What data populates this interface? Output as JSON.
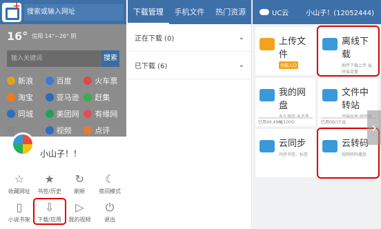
{
  "browser": {
    "url_placeholder": "搜索或输入网址",
    "weather": {
      "temp": "16°",
      "detail": "信阳 14°~26° 阴"
    },
    "search": {
      "placeholder": "输入关键词",
      "button": "搜索"
    },
    "sites": [
      {
        "label": "新浪",
        "color": "#e3a11b"
      },
      {
        "label": "百度",
        "color": "#3a7bd5"
      },
      {
        "label": "火车票",
        "color": "#e04848"
      },
      {
        "label": "淘宝",
        "color": "#f27a1a"
      },
      {
        "label": "亚马逊",
        "color": "#2a6bb7"
      },
      {
        "label": "赶集",
        "color": "#3bae4a"
      },
      {
        "label": "同城",
        "color": "#2d6ec1"
      },
      {
        "label": "美团网",
        "color": "#25a05a"
      },
      {
        "label": "有缘网",
        "color": "#e05050"
      },
      {
        "label": "",
        "color": "#888"
      },
      {
        "label": "视频",
        "color": "#2d6ec1"
      },
      {
        "label": "点评",
        "color": "#e87b2c"
      }
    ],
    "menu": {
      "username": "小山子！！",
      "items": [
        {
          "label": "收藏网址",
          "icon": "star-icon"
        },
        {
          "label": "书签/历史",
          "icon": "bookmark-icon"
        },
        {
          "label": "刷新",
          "icon": "refresh-icon"
        },
        {
          "label": "夜间模式",
          "icon": "moon-icon"
        },
        {
          "label": "小说书架",
          "icon": "book-icon"
        },
        {
          "label": "下载/应用",
          "icon": "download-icon"
        },
        {
          "label": "我的视频",
          "icon": "video-icon"
        },
        {
          "label": "退出",
          "icon": "power-icon"
        }
      ]
    }
  },
  "downloads": {
    "tabs": [
      "下载管理",
      "手机文件",
      "热门资源"
    ],
    "rows": [
      {
        "label": "正在下载 (0)"
      },
      {
        "label": "已下载 (6)"
      }
    ]
  },
  "cloud": {
    "brand": "UC云",
    "user": "小山子！(12052444)",
    "tiles": [
      {
        "title": "上传文件",
        "sub": "",
        "badge": "全能入口",
        "color": "#f4a21c",
        "highlight": false
      },
      {
        "title": "离线下载",
        "sub": "图传下载上传 省时省流量",
        "badge": "",
        "color": "#3a9ad9",
        "highlight": true
      },
      {
        "title": "我的网盘",
        "sub": "永久保存 永不丢失",
        "meta": "已用49.49M/100G",
        "color": "#3a9ad9",
        "highlight": false
      },
      {
        "title": "文件中转站",
        "sub": "传输共享 即传即得",
        "meta": "已用0B/1T",
        "color": "#3a9ad9",
        "highlight": false
      },
      {
        "title": "云同步",
        "sub": "同步书签、标签",
        "color": "#3a9ad9",
        "highlight": false
      },
      {
        "title": "云转码",
        "sub": "视频转码播放",
        "color": "#3a9ad9",
        "highlight": true
      }
    ]
  }
}
